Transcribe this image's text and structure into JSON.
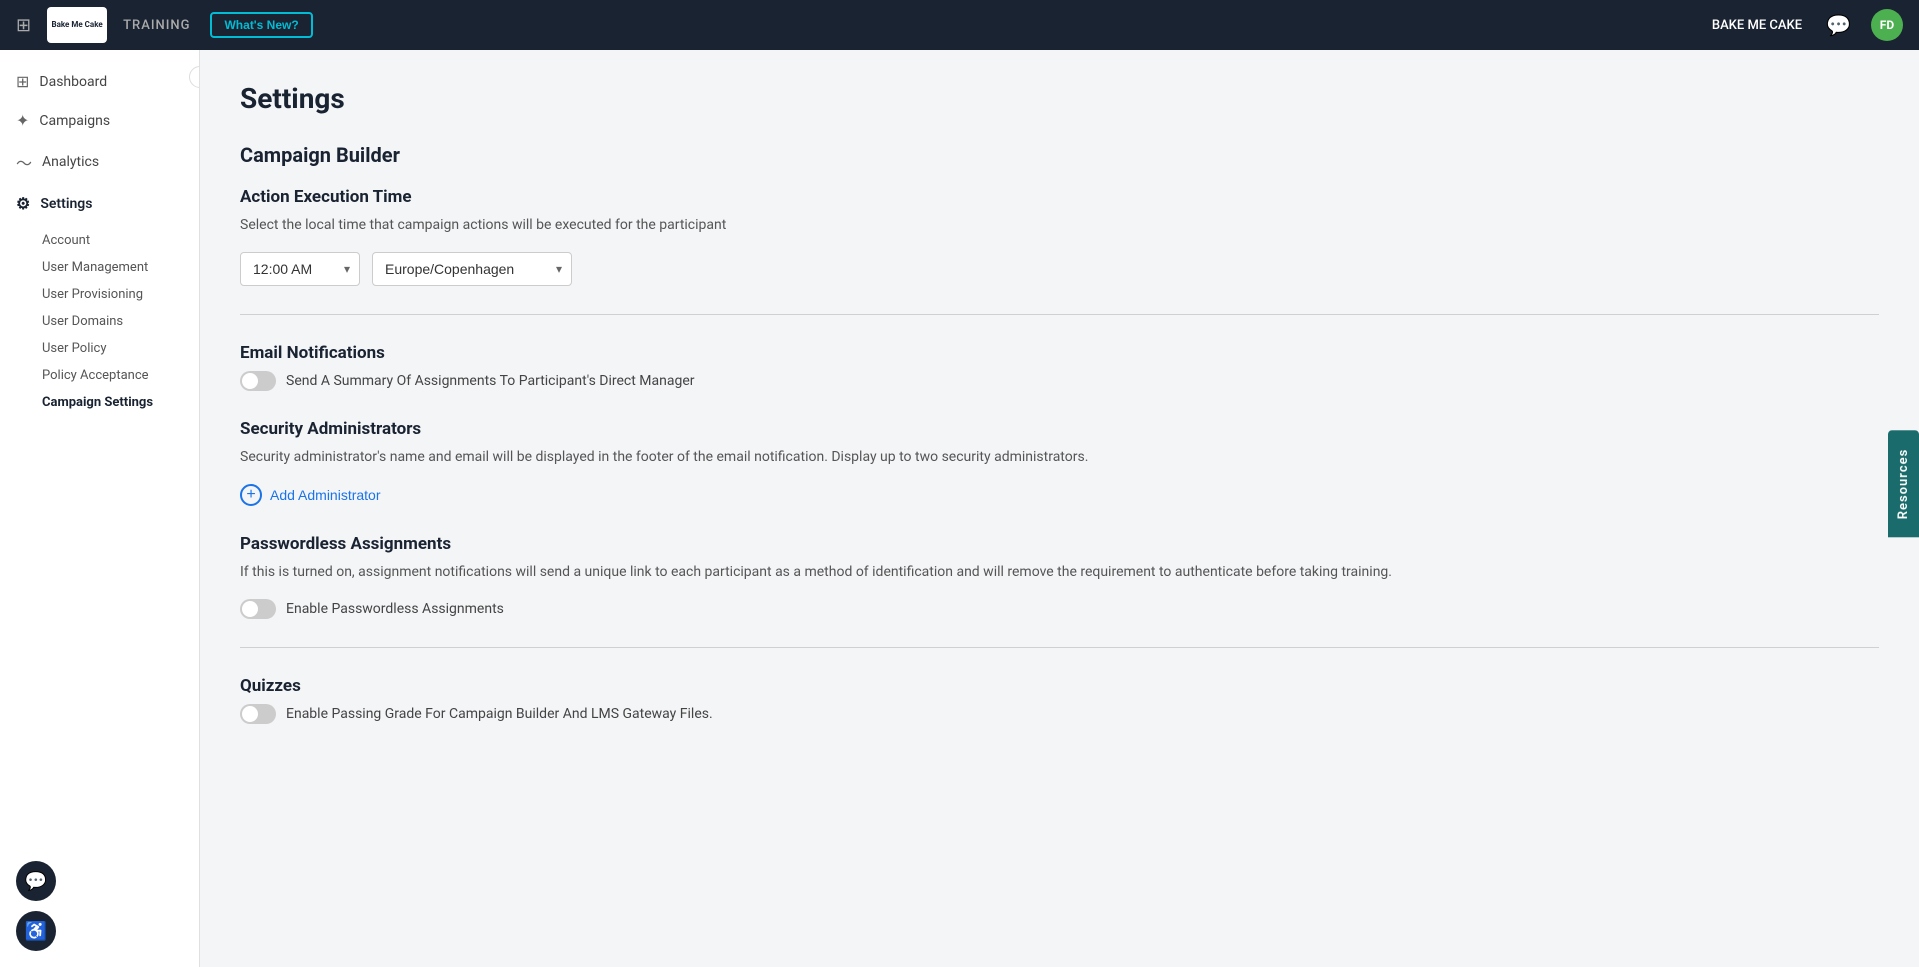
{
  "topnav": {
    "logo_text": "Bake\nMe\nCake",
    "training_label": "TRAINING",
    "whats_new_label": "What's New?",
    "brand_label": "BAKE ME CAKE",
    "avatar_label": "FD"
  },
  "sidebar": {
    "collapse_icon": "‹",
    "items": [
      {
        "id": "dashboard",
        "label": "Dashboard",
        "icon": "⊞",
        "active": false
      },
      {
        "id": "campaigns",
        "label": "Campaigns",
        "icon": "✦",
        "active": false
      },
      {
        "id": "analytics",
        "label": "Analytics",
        "icon": "∿",
        "active": false
      },
      {
        "id": "settings",
        "label": "Settings",
        "icon": "⚙",
        "active": true
      }
    ],
    "subitems": [
      {
        "id": "account",
        "label": "Account",
        "active": false
      },
      {
        "id": "user-management",
        "label": "User Management",
        "active": false
      },
      {
        "id": "user-provisioning",
        "label": "User Provisioning",
        "active": false
      },
      {
        "id": "user-domains",
        "label": "User Domains",
        "active": false
      },
      {
        "id": "user-policy",
        "label": "User Policy",
        "active": false
      },
      {
        "id": "policy-acceptance",
        "label": "Policy Acceptance",
        "active": false
      },
      {
        "id": "campaign-settings",
        "label": "Campaign Settings",
        "active": true
      }
    ],
    "chat_icon": "💬",
    "accessibility_icon": "♿"
  },
  "main": {
    "page_title": "Settings",
    "campaign_builder_title": "Campaign Builder",
    "action_execution_title": "Action Execution Time",
    "action_execution_desc": "Select the local time that campaign actions will be executed for the participant",
    "time_value": "12:00 AM",
    "timezone_value": "Europe/Copenhagen",
    "email_notifications_title": "Email Notifications",
    "email_toggle_label": "Send A Summary Of Assignments To Participant's Direct Manager",
    "security_admins_title": "Security Administrators",
    "security_admins_desc": "Security administrator's name and email will be displayed in the footer of the email notification. Display up to two security administrators.",
    "add_admin_label": "Add Administrator",
    "passwordless_title": "Passwordless Assignments",
    "passwordless_desc": "If this is turned on, assignment notifications will send a unique link to each participant as a method of identification and will remove the requirement to authenticate before taking training.",
    "passwordless_toggle_label": "Enable Passwordless Assignments",
    "quizzes_title": "Quizzes",
    "quizzes_toggle_label": "Enable Passing Grade For Campaign Builder And LMS Gateway Files.",
    "resources_label": "Resources"
  }
}
